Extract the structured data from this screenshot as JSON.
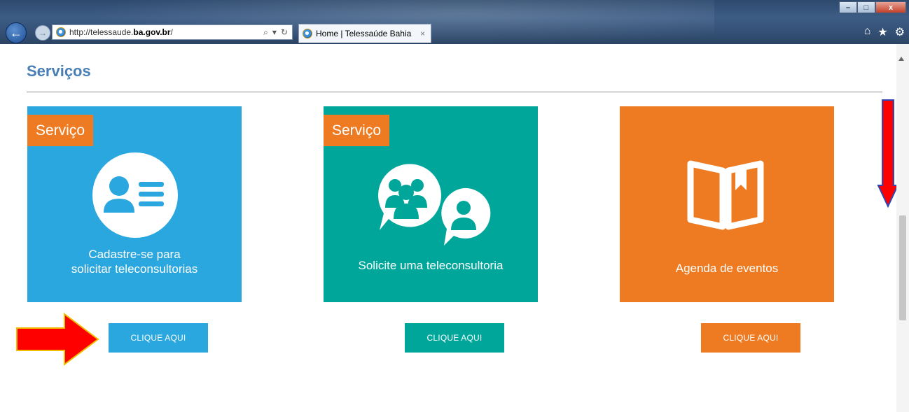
{
  "browser": {
    "url_prefix": "http://telessaude.",
    "url_domain": "ba.gov.br",
    "url_suffix": "/",
    "tab_title": "Home | Telessaúde Bahia",
    "tab_close": "×",
    "search_icon": "⌕",
    "dropdown_icon": "▾",
    "refresh_icon": "↻",
    "back_icon": "←",
    "forward_icon": "→",
    "home_icon": "⌂",
    "favorites_icon": "★",
    "tools_icon": "⚙",
    "minimize_icon": "–",
    "maximize_icon": "□",
    "close_icon": "x"
  },
  "page": {
    "title": "Serviços"
  },
  "cards": [
    {
      "badge": "Serviço",
      "caption_line1": "Cadastre-se para",
      "caption_line2": "solicitar teleconsultorias",
      "icon": "user-card-icon",
      "color": "#2aa7df",
      "button": "CLIQUE AQUI"
    },
    {
      "badge": "Serviço",
      "caption_line1": "Solicite uma teleconsultoria",
      "icon": "people-chat-icon",
      "color": "#00a69a",
      "button": "CLIQUE AQUI"
    },
    {
      "caption_line1": "Agenda de eventos",
      "icon": "open-book-icon",
      "color": "#ee7b22",
      "button": "CLIQUE AQUI"
    }
  ],
  "colors": {
    "badge": "#ee7b22",
    "title": "#4a7fb5",
    "annotation_arrow": "#ff0000"
  }
}
